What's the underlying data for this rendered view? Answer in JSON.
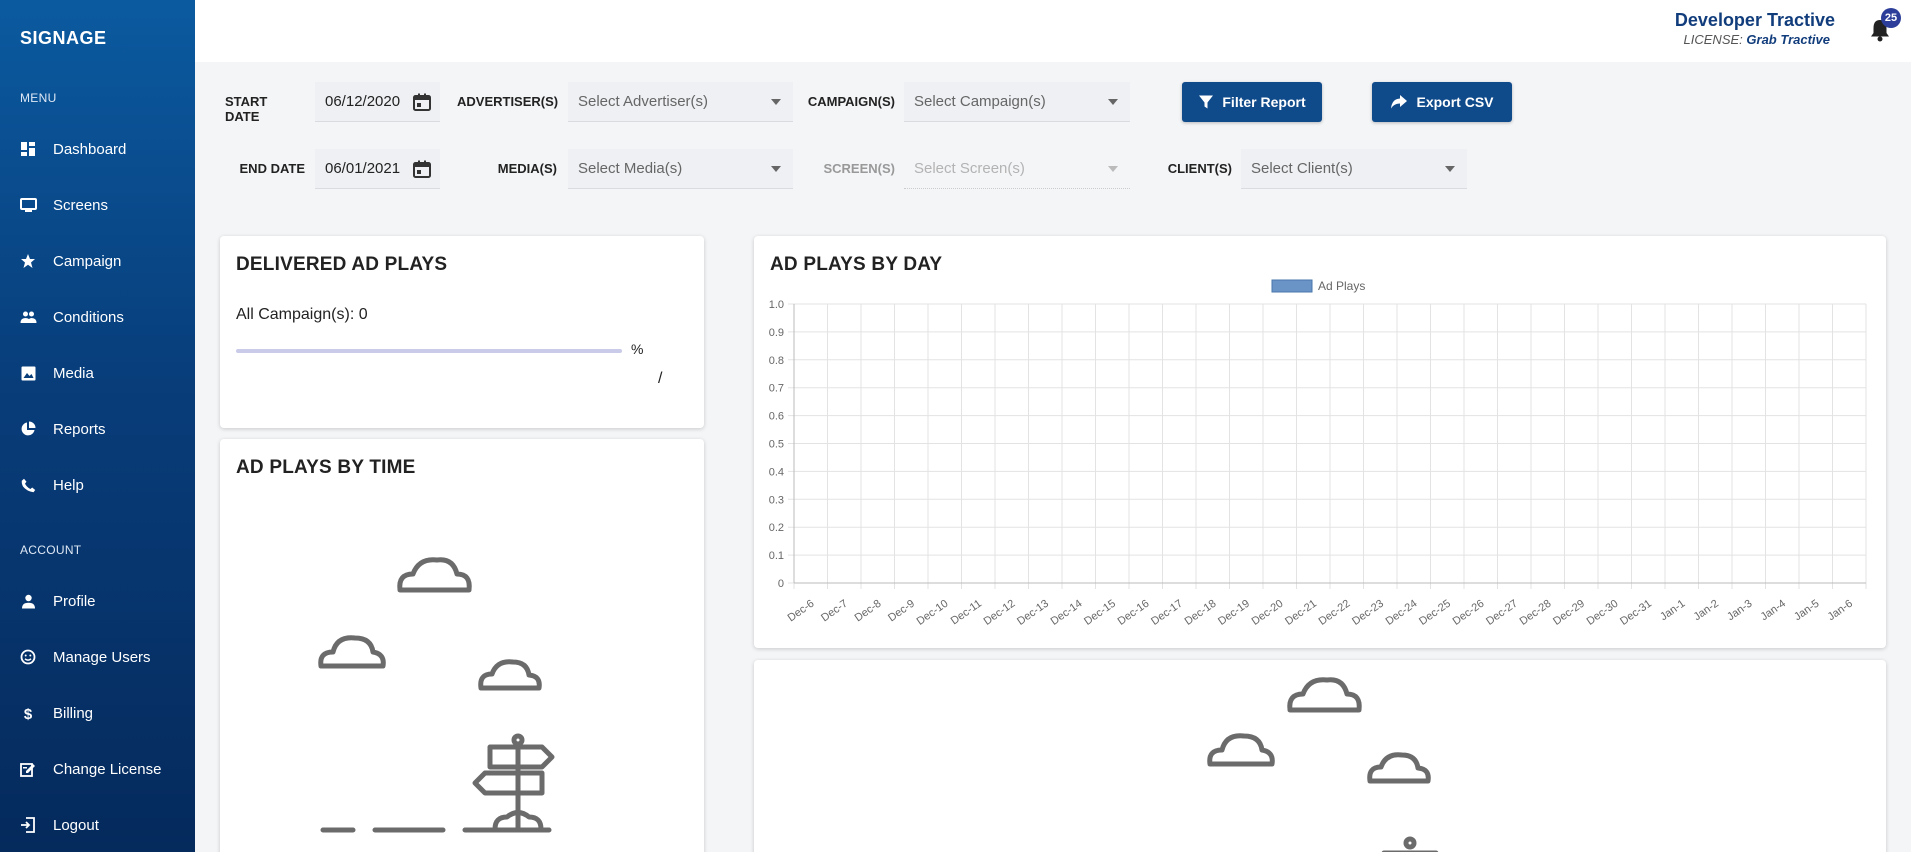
{
  "sidebar": {
    "brand": "SIGNAGE",
    "menu_label": "MENU",
    "account_label": "ACCOUNT",
    "menu_items": [
      {
        "label": "Dashboard",
        "icon": "dashboard-icon"
      },
      {
        "label": "Screens",
        "icon": "monitor-icon"
      },
      {
        "label": "Campaign",
        "icon": "star-icon"
      },
      {
        "label": "Conditions",
        "icon": "people-icon"
      },
      {
        "label": "Media",
        "icon": "image-icon"
      },
      {
        "label": "Reports",
        "icon": "pie-chart-icon"
      },
      {
        "label": "Help",
        "icon": "phone-icon"
      }
    ],
    "account_items": [
      {
        "label": "Profile",
        "icon": "person-icon"
      },
      {
        "label": "Manage Users",
        "icon": "smiley-icon"
      },
      {
        "label": "Billing",
        "icon": "dollar-icon"
      },
      {
        "label": "Change License",
        "icon": "edit-icon"
      },
      {
        "label": "Logout",
        "icon": "logout-icon"
      }
    ]
  },
  "header": {
    "user_name": "Developer Tractive",
    "license_prefix": "LICENSE:",
    "license_name": "Grab Tractive",
    "notification_count": "25"
  },
  "filters": {
    "start_date_label": "START DATE",
    "start_date_value": "06/12/2020",
    "end_date_label": "END DATE",
    "end_date_value": "06/01/2021",
    "advertiser_label": "ADVERTISER(S)",
    "advertiser_placeholder": "Select Advertiser(s)",
    "campaign_label": "CAMPAIGN(S)",
    "campaign_placeholder": "Select Campaign(s)",
    "media_label": "MEDIA(S)",
    "media_placeholder": "Select Media(s)",
    "screen_label": "SCREEN(S)",
    "screen_placeholder": "Select Screen(s)",
    "client_label": "CLIENT(S)",
    "client_placeholder": "Select Client(s)",
    "filter_button": "Filter Report",
    "export_button": "Export CSV"
  },
  "delivered": {
    "title": "DELIVERED AD PLAYS",
    "campaign_text": "All Campaign(s): 0",
    "percent_symbol": "%",
    "progress": 0,
    "slash": "/"
  },
  "by_time": {
    "title": "AD PLAYS BY TIME"
  },
  "by_day": {
    "title": "AD PLAYS BY DAY"
  },
  "chart_data": {
    "type": "bar",
    "title": "",
    "xlabel": "",
    "ylabel": "",
    "ylim": [
      0,
      1.0
    ],
    "yticks": [
      "0",
      "0.1",
      "0.2",
      "0.3",
      "0.4",
      "0.5",
      "0.6",
      "0.7",
      "0.8",
      "0.9",
      "1.0"
    ],
    "legend_position": "top",
    "grid": true,
    "series_color": "#6a93c6",
    "categories": [
      "Dec-6",
      "Dec-7",
      "Dec-8",
      "Dec-9",
      "Dec-10",
      "Dec-11",
      "Dec-12",
      "Dec-13",
      "Dec-14",
      "Dec-15",
      "Dec-16",
      "Dec-17",
      "Dec-18",
      "Dec-19",
      "Dec-20",
      "Dec-21",
      "Dec-22",
      "Dec-23",
      "Dec-24",
      "Dec-25",
      "Dec-26",
      "Dec-27",
      "Dec-28",
      "Dec-29",
      "Dec-30",
      "Dec-31",
      "Jan-1",
      "Jan-2",
      "Jan-3",
      "Jan-4",
      "Jan-5",
      "Jan-6"
    ],
    "series": [
      {
        "name": "Ad Plays",
        "values": [
          0,
          0,
          0,
          0,
          0,
          0,
          0,
          0,
          0,
          0,
          0,
          0,
          0,
          0,
          0,
          0,
          0,
          0,
          0,
          0,
          0,
          0,
          0,
          0,
          0,
          0,
          0,
          0,
          0,
          0,
          0,
          0
        ]
      }
    ]
  }
}
